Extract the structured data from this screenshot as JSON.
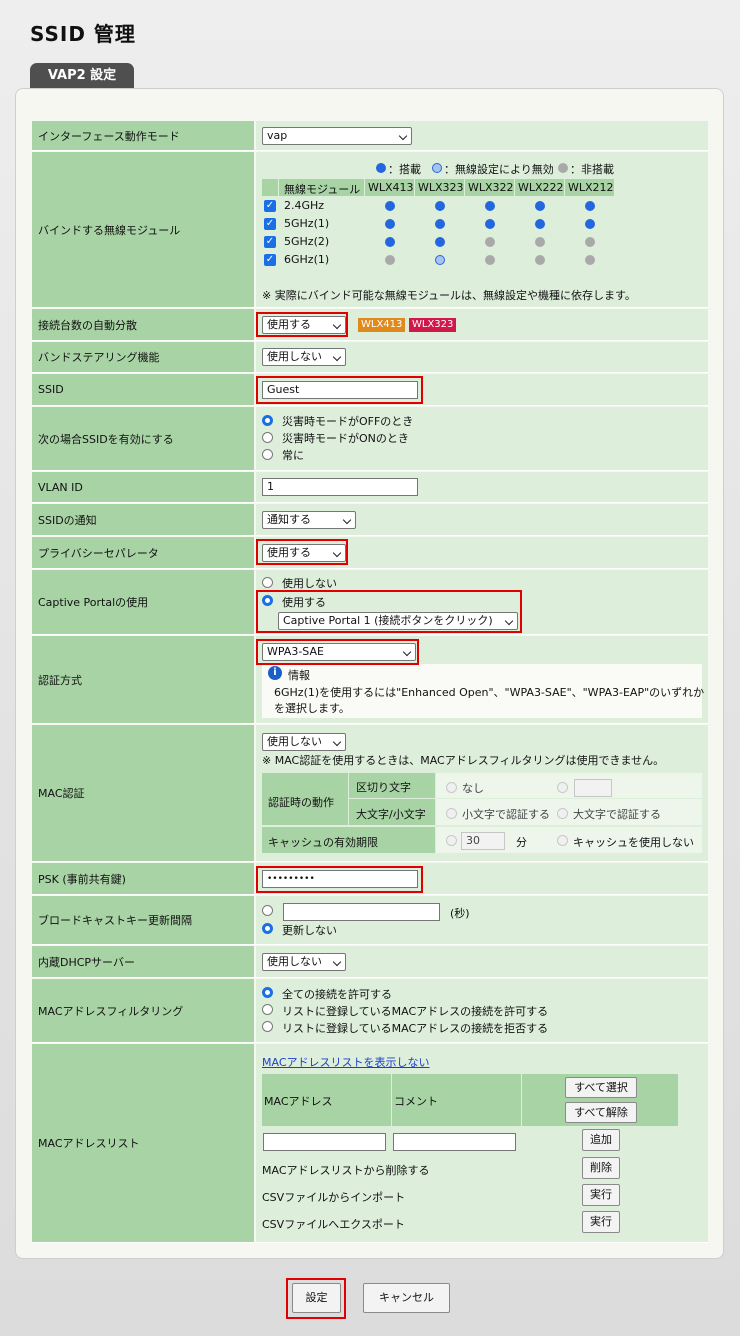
{
  "page": {
    "title": "SSID 管理",
    "tab": "VAP2 設定"
  },
  "colors": {
    "label_bg": "#a8d3a5",
    "value_bg": "#ddeedb",
    "highlight": "#e00000",
    "wlx413": "#e08a1e",
    "wlx323": "#d0184a"
  },
  "rows": {
    "iface_mode": {
      "label": "インターフェース動作モード",
      "value": "vap"
    },
    "bind": {
      "label": "バインドする無線モジュール",
      "legend": {
        "on": "：搭載",
        "dis": "：無線設定により無効",
        "off": "：非搭載"
      },
      "header": [
        "無線モジュール",
        "WLX413",
        "WLX323",
        "WLX322",
        "WLX222",
        "WLX212"
      ],
      "modules": [
        "2.4GHz",
        "5GHz(1)",
        "5GHz(2)",
        "6GHz(1)"
      ],
      "note": "※ 実際にバインド可能な無線モジュールは、無線設定や機種に依存します。"
    },
    "auto_dist": {
      "label": "接続台数の自動分散",
      "value": "使用する",
      "badges": [
        "WLX413",
        "WLX323"
      ]
    },
    "band_steer": {
      "label": "バンドステアリング機能",
      "value": "使用しない"
    },
    "ssid": {
      "label": "SSID",
      "value": "Guest"
    },
    "enable_when": {
      "label": "次の場合SSIDを有効にする",
      "options": [
        "災害時モードがOFFのとき",
        "災害時モードがONのとき",
        "常に"
      ]
    },
    "vlan": {
      "label": "VLAN ID",
      "value": "1"
    },
    "ssid_notify": {
      "label": "SSIDの通知",
      "value": "通知する"
    },
    "privacy": {
      "label": "プライバシーセパレータ",
      "value": "使用する"
    },
    "captive": {
      "label": "Captive Portalの使用",
      "options": [
        "使用しない",
        "使用する"
      ],
      "select": "Captive Portal 1 (接続ボタンをクリック)"
    },
    "auth": {
      "label": "認証方式",
      "value": "WPA3-SAE",
      "info_title": "情報",
      "info_line1": "6GHz(1)を使用するには\"Enhanced Open\"、\"WPA3-SAE\"、\"WPA3-EAP\"のいずれか",
      "info_line2": "を選択します。"
    },
    "mac_auth": {
      "label": "MAC認証",
      "value": "使用しない",
      "note": "※ MAC認証を使用するときは、MACアドレスフィルタリングは使用できません。",
      "action_label": "認証時の動作",
      "sep_label": "区切り文字",
      "sep_none": "なし",
      "case_label": "大文字/小文字",
      "case_lower": "小文字で認証する",
      "case_upper": "大文字で認証する",
      "cache_label": "キャッシュの有効期限",
      "cache_value": "30",
      "cache_unit": "分",
      "cache_none": "キャッシュを使用しない"
    },
    "psk": {
      "label": "PSK (事前共有鍵)",
      "value": "•••••••••"
    },
    "bcast": {
      "label": "ブロードキャストキー更新間隔",
      "unit": "(秒)",
      "no_update": "更新しない"
    },
    "dhcp": {
      "label": "内蔵DHCPサーバー",
      "value": "使用しない"
    },
    "mac_filter": {
      "label": "MACアドレスフィルタリング",
      "options": [
        "全ての接続を許可する",
        "リストに登録しているMACアドレスの接続を許可する",
        "リストに登録しているMACアドレスの接続を拒否する"
      ]
    },
    "mac_list": {
      "label": "MACアドレスリスト",
      "link": "MACアドレスリストを表示しない",
      "col_mac": "MACアドレス",
      "col_comment": "コメント",
      "select_all": "すべて選択",
      "deselect_all": "すべて解除",
      "add": "追加",
      "delete_label": "MACアドレスリストから削除する",
      "delete_btn": "削除",
      "import_label": "CSVファイルからインポート",
      "import_btn": "実行",
      "export_label": "CSVファイルへエクスポート",
      "export_btn": "実行"
    }
  },
  "footer": {
    "submit": "設定",
    "cancel": "キャンセル"
  }
}
